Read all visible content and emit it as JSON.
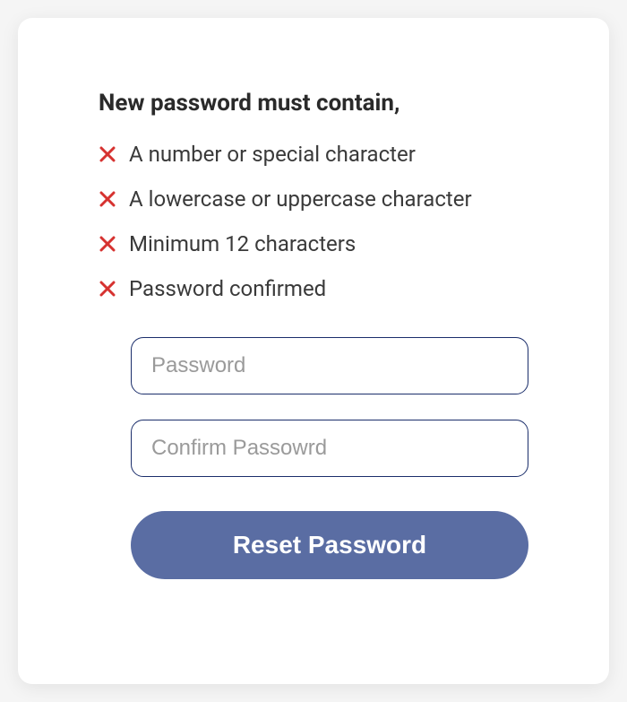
{
  "title": "New password must contain,",
  "requirements": [
    {
      "met": false,
      "text": "A number or special character"
    },
    {
      "met": false,
      "text": "A lowercase or uppercase character"
    },
    {
      "met": false,
      "text": "Minimum 12 characters"
    },
    {
      "met": false,
      "text": "Password confirmed"
    }
  ],
  "fields": {
    "password": {
      "placeholder": "Password",
      "value": ""
    },
    "confirm": {
      "placeholder": "Confirm Passowrd",
      "value": ""
    }
  },
  "button": {
    "label": "Reset Password"
  },
  "colors": {
    "error": "#d63230",
    "border": "#1b2e6b",
    "primary": "#5a6da3"
  }
}
